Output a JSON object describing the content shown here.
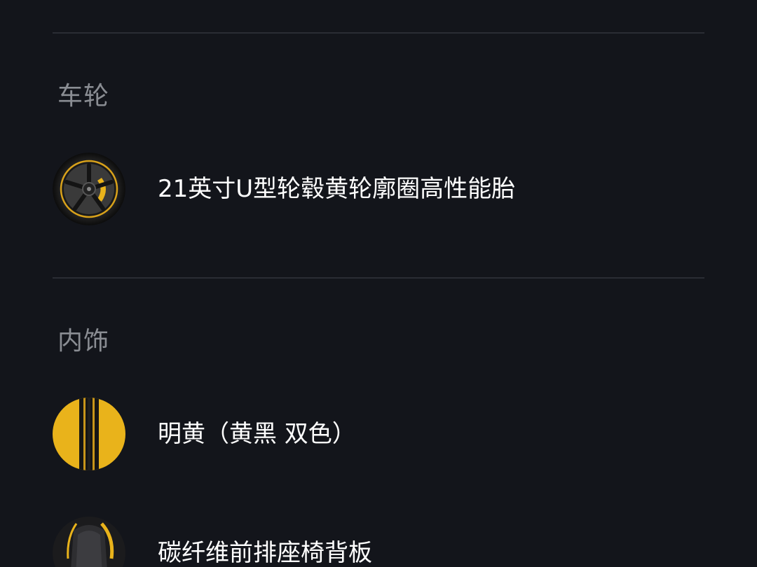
{
  "sections": [
    {
      "title": "车轮",
      "options": [
        {
          "label": "21英寸U型轮毂黄轮廓圈高性能胎",
          "icon": "wheel-icon"
        }
      ]
    },
    {
      "title": "内饰",
      "options": [
        {
          "label": "明黄（黄黑 双色）",
          "icon": "yellow-black-swatch-icon"
        },
        {
          "label": "碳纤维前排座椅背板",
          "icon": "carbon-seat-back-icon"
        }
      ]
    }
  ],
  "colors": {
    "background": "#13151b",
    "divider": "#2a2d34",
    "section_title": "#8a8d93",
    "accent_yellow": "#e9b31b"
  }
}
